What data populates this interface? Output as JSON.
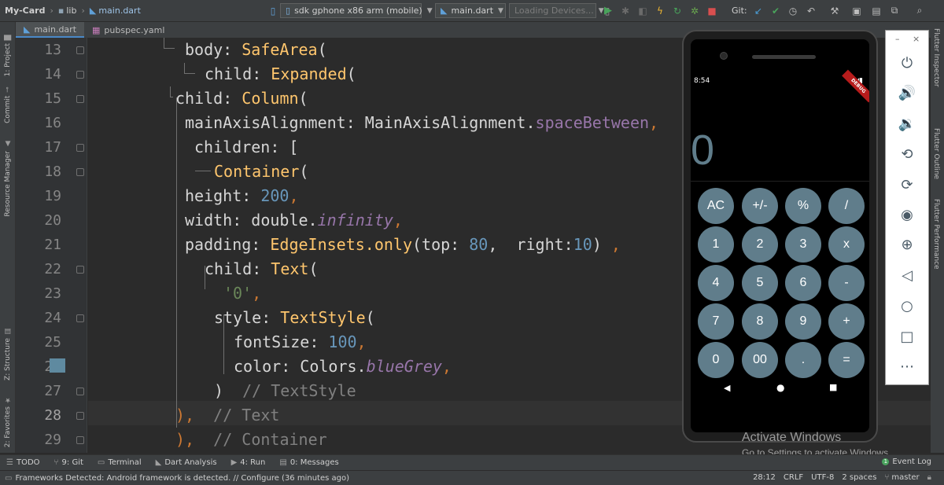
{
  "breadcrumb": {
    "project": "My-Card",
    "folder": "lib",
    "file": "main.dart"
  },
  "toolbar": {
    "device": "sdk gphone x86 arm (mobile)",
    "run_config": "main.dart",
    "devices": "Loading Devices...",
    "git_label": "Git:"
  },
  "left_tabs": [
    "1: Project",
    "Commit",
    "Resource Manager",
    "Z: Structure",
    "2: Favorites"
  ],
  "right_tabs": [
    "Flutter Inspector",
    "Flutter Outline",
    "Flutter Performance"
  ],
  "editor_tabs": [
    "main.dart",
    "pubspec.yaml"
  ],
  "line_numbers": [
    "13",
    "14",
    "15",
    "16",
    "17",
    "18",
    "19",
    "20",
    "21",
    "22",
    "23",
    "24",
    "25",
    "26",
    "27",
    "28",
    "29"
  ],
  "code": {
    "l13_a": "body: ",
    "l13_b": "SafeArea",
    "l13_c": "(",
    "l14_a": "child: ",
    "l14_b": "Expanded",
    "l14_c": "(",
    "l15_a": "child: ",
    "l15_b": "Column",
    "l15_c": "(",
    "l16_a": "mainAxisAlignment: MainAxisAlignment.",
    "l16_b": "spaceBetween",
    "l16_c": ",",
    "l17_a": "children: [",
    "l18_a": "Container",
    "l18_b": "(",
    "l19_a": "height: ",
    "l19_b": "200",
    "l19_c": ",",
    "l20_a": "width: double.",
    "l20_b": "infinity",
    "l20_c": ",",
    "l21_a": "padding: ",
    "l21_b": "EdgeInsets.only",
    "l21_c": "(top: ",
    "l21_d": "80",
    "l21_e": ",  right:",
    "l21_f": "10",
    "l21_g": ") ",
    "l21_h": ",",
    "l22_a": "child: ",
    "l22_b": "Text",
    "l22_c": "(",
    "l23_a": "'0'",
    "l23_b": ",",
    "l24_a": "style: ",
    "l24_b": "TextStyle",
    "l24_c": "(",
    "l25_a": "fontSize: ",
    "l25_b": "100",
    "l25_c": ",",
    "l26_a": "color: Colors.",
    "l26_b": "blueGrey",
    "l26_c": ",",
    "l27_a": ")  ",
    "l27_b": "// TextStyle",
    "l28_a": "), ",
    "l28_b": " // Text",
    "l29_a": "), ",
    "l29_b": " // Container"
  },
  "phone": {
    "time": "8:54",
    "status_right": "▾◢▮",
    "debug_banner": "DEBUG",
    "display": "0",
    "buttons": [
      "AC",
      "+/-",
      "%",
      "/",
      "1",
      "2",
      "3",
      "x",
      "4",
      "5",
      "6",
      "-",
      "7",
      "8",
      "9",
      "+",
      "0",
      "00",
      ".",
      "="
    ]
  },
  "emulator_panel": {
    "minimize": "–",
    "close": "×"
  },
  "watermark": {
    "line1": "Activate Windows",
    "line2": "Go to Settings to activate Windows."
  },
  "bottom_tabs": [
    "TODO",
    "9: Git",
    "Terminal",
    "Dart Analysis",
    "4: Run",
    "0: Messages"
  ],
  "event_log": {
    "badge": "1",
    "label": "Event Log"
  },
  "status": {
    "message": "Frameworks Detected: Android framework is detected. // Configure (36 minutes ago)",
    "position": "28:12",
    "line_sep": "CRLF",
    "encoding": "UTF-8",
    "indent": "2 spaces",
    "branch": "master"
  },
  "colors": {
    "accent": "#4a88c7",
    "calc_button": "#607d8b",
    "keyword": "#ffc66d",
    "number": "#6897bb",
    "property": "#9876aa",
    "comment": "#808080"
  }
}
